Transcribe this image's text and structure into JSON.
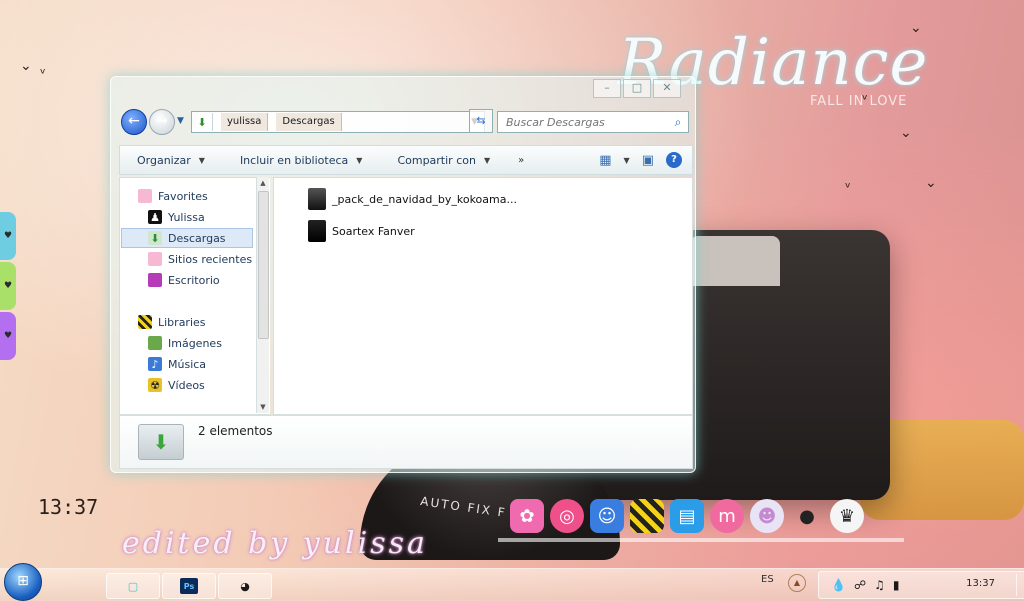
{
  "wallpaper": {
    "title": "Radiance",
    "subtitle": "FALL IN LOVE",
    "clock_text": "13:37",
    "edited_text": "edited by yulissa",
    "lens_text": "AUTO FIX F"
  },
  "window": {
    "controls": {
      "minimize": "–",
      "maximize": "□",
      "close": "✕"
    },
    "address": {
      "crumbs": [
        "yulissa",
        "Descargas"
      ],
      "search_placeholder": "Buscar Descargas"
    },
    "toolbar": {
      "organize": "Organizar",
      "include": "Incluir en biblioteca",
      "share": "Compartir con",
      "more": "»"
    },
    "nav": {
      "favorites": "Favorites",
      "yulissa": "Yulissa",
      "downloads": "Descargas",
      "recent": "Sitios recientes",
      "desktop": "Escritorio",
      "libraries": "Libraries",
      "images": "Imágenes",
      "music": "Música",
      "videos": "Vídeos"
    },
    "files": [
      "_pack_de_navidad_by_kokoama...",
      "Soartex Fanver"
    ],
    "status": "2 elementos"
  },
  "taskbar": {
    "lang": "ES",
    "clock": "13:37"
  },
  "colors": {
    "accent": "#2a6acb",
    "window_glow": "#78d2cd"
  }
}
